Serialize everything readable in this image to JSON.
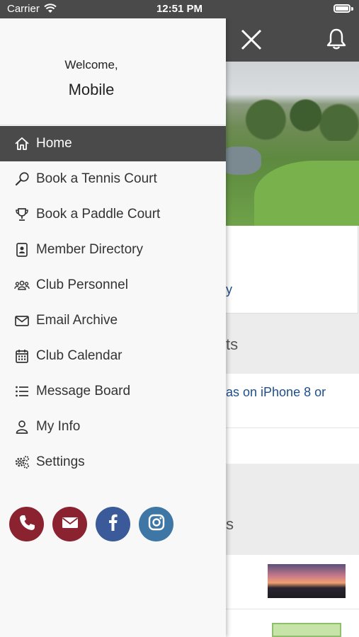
{
  "status_bar": {
    "carrier": "Carrier",
    "time": "12:51 PM"
  },
  "drawer": {
    "welcome": "Welcome,",
    "username": "Mobile",
    "items": [
      {
        "label": "Home",
        "icon": "home-icon",
        "active": true
      },
      {
        "label": "Book a Tennis Court",
        "icon": "tennis-racket-icon"
      },
      {
        "label": "Book a Paddle Court",
        "icon": "trophy-icon"
      },
      {
        "label": "Member Directory",
        "icon": "contact-book-icon"
      },
      {
        "label": "Club Personnel",
        "icon": "people-icon"
      },
      {
        "label": "Email Archive",
        "icon": "envelope-icon"
      },
      {
        "label": "Club Calendar",
        "icon": "calendar-icon"
      },
      {
        "label": "Message Board",
        "icon": "list-icon"
      },
      {
        "label": "My Info",
        "icon": "user-icon"
      },
      {
        "label": "Settings",
        "icon": "gears-icon"
      }
    ],
    "social": [
      {
        "name": "phone-button",
        "icon": "phone-icon",
        "color": "#8b2230"
      },
      {
        "name": "email-button",
        "icon": "mail-icon",
        "color": "#8b2230"
      },
      {
        "name": "facebook-button",
        "icon": "facebook-icon",
        "color": "#3b5a9a"
      },
      {
        "name": "instagram-button",
        "icon": "instagram-icon",
        "color": "#3e77a6"
      }
    ]
  },
  "background": {
    "card_link_fragment": "y",
    "section1_fragment": "ts",
    "row_fragment": "as on iPhone 8 or",
    "section2_fragment": "s"
  },
  "colors": {
    "header": "#4a4a4a",
    "accent_red": "#8b2230",
    "link_blue": "#1e4f8a"
  }
}
